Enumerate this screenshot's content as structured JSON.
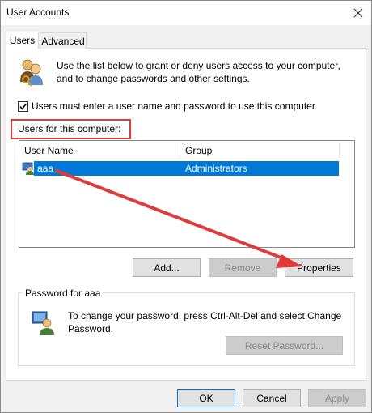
{
  "window": {
    "title": "User Accounts"
  },
  "tabs": [
    {
      "label": "Users",
      "active": true
    },
    {
      "label": "Advanced",
      "active": false
    }
  ],
  "intro_text": "Use the list below to grant or deny users access to your computer, and to change passwords and other settings.",
  "require_login": {
    "label": "Users must enter a user name and password to use this computer.",
    "checked": true
  },
  "users_section_label": "Users for this computer:",
  "users_table": {
    "columns": [
      "User Name",
      "Group"
    ],
    "rows": [
      {
        "name": "aaa",
        "group": "Administrators",
        "selected": true
      }
    ]
  },
  "user_buttons": {
    "add": "Add...",
    "remove": "Remove",
    "properties": "Properties"
  },
  "password_group": {
    "title": "Password for aaa",
    "text": "To change your password, press Ctrl-Alt-Del and select Change Password.",
    "reset_button": "Reset Password..."
  },
  "dialog_buttons": {
    "ok": "OK",
    "cancel": "Cancel",
    "apply": "Apply"
  },
  "colors": {
    "accent": "#0078d7",
    "annotation": "#e03a3a"
  }
}
